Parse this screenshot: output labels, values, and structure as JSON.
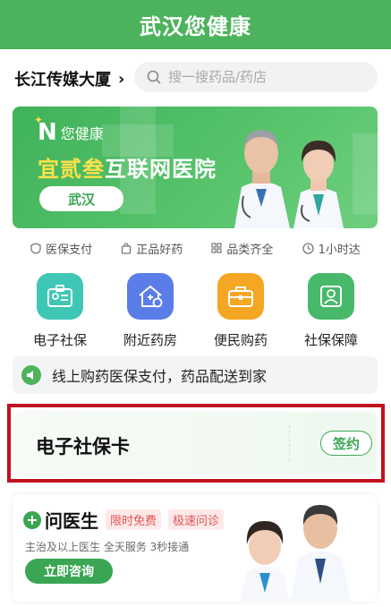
{
  "app": {
    "title": "武汉您健康"
  },
  "location": {
    "label": "长江传媒大厦",
    "chevron": "›"
  },
  "search": {
    "placeholder": "搜一搜药品/药店"
  },
  "banner": {
    "brand_logo": "N",
    "brand_name": "您健康",
    "title_highlight": "宜贰叁",
    "title_rest": "互联网医院",
    "city_button": "武汉"
  },
  "features": [
    {
      "icon": "shield-icon",
      "label": "医保支付"
    },
    {
      "icon": "bag-icon",
      "label": "正品好药"
    },
    {
      "icon": "grid-icon",
      "label": "品类齐全"
    },
    {
      "icon": "clock-icon",
      "label": "1小时达"
    }
  ],
  "services": [
    {
      "icon": "id-card-icon",
      "label": "电子社保",
      "color": "#3fc7b5"
    },
    {
      "icon": "pharmacy-house-icon",
      "label": "附近药房",
      "color": "#5b7de8"
    },
    {
      "icon": "medicine-kit-icon",
      "label": "便民购药",
      "color": "#f5a623"
    },
    {
      "icon": "user-card-icon",
      "label": "社保保障",
      "color": "#48b96a"
    }
  ],
  "notice": {
    "text": "线上购药医保支付，药品配送到家"
  },
  "social_security_card": {
    "title": "电子社保卡",
    "sign_button": "签约"
  },
  "ask_doctor": {
    "plus": "+",
    "title": "问医生",
    "tags": [
      "限时免费",
      "极速问诊"
    ],
    "subtitle": "主治及以上医生 全天服务 3秒接通",
    "consult_button": "立即咨询"
  },
  "colors": {
    "primary": "#4cb35c",
    "highlight_frame": "#c0121f",
    "tag_red": "#e35454"
  }
}
